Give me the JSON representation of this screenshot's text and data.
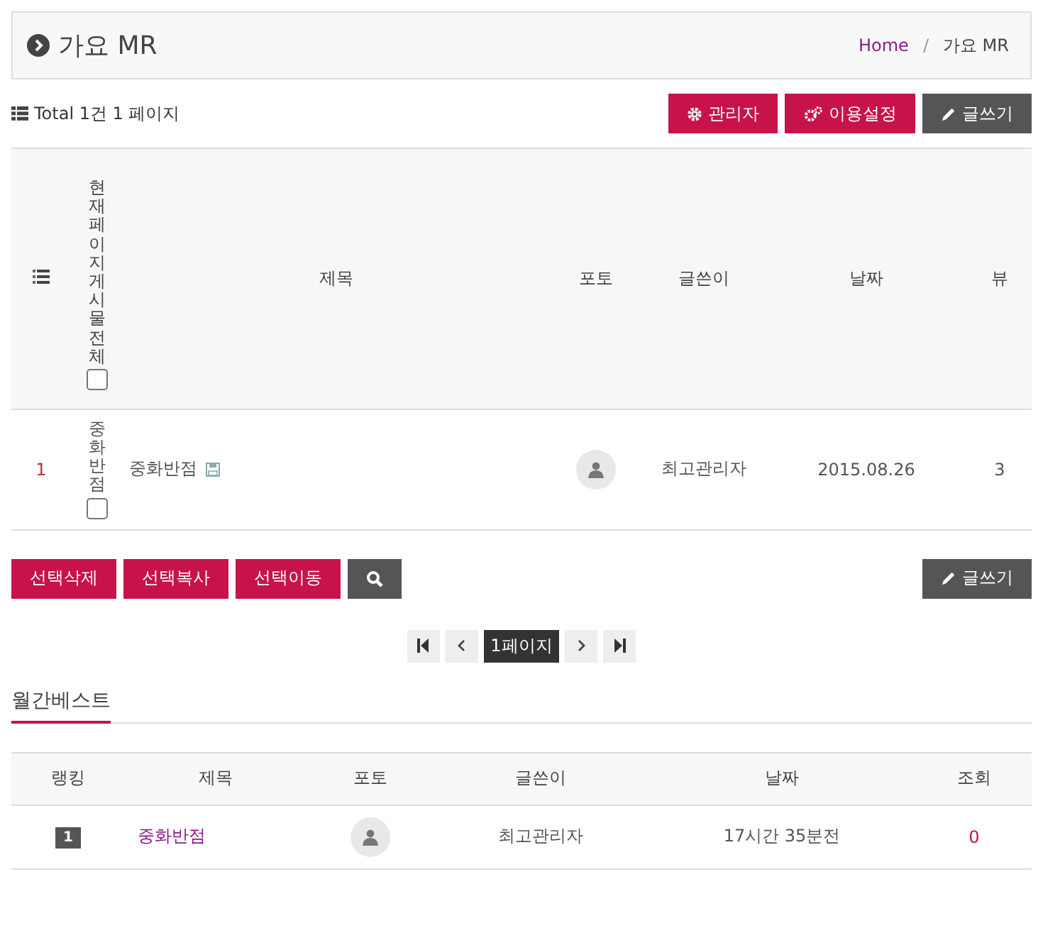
{
  "header": {
    "title": "가요 MR",
    "breadcrumb": [
      {
        "label": "Home",
        "kind": "link"
      },
      {
        "label": "/",
        "kind": "separator"
      },
      {
        "label": "가요 MR",
        "kind": "current"
      }
    ]
  },
  "toolbar": {
    "summary": "Total 1건 1 페이지",
    "buttons": [
      {
        "label": "관리자",
        "kind": "admin"
      },
      {
        "label": "이용설정",
        "kind": "settings"
      },
      {
        "label": "글쓰기",
        "kind": "write"
      }
    ]
  },
  "table": {
    "select_all": {
      "label": "현재페이지게시물전체",
      "checked": false
    },
    "columns": [
      "제목",
      "포토",
      "글쓴이",
      "날짜",
      "뷰"
    ],
    "rows": [
      {
        "number": "1",
        "select_label": "중화반점",
        "checked": false,
        "title": "중화반점",
        "author": "최고관리자",
        "date": "2015.08.26",
        "views": "3"
      }
    ]
  },
  "actions": [
    {
      "label": "선택삭제",
      "kind": "primary"
    },
    {
      "label": "선택복사",
      "kind": "primary"
    },
    {
      "label": "선택이동",
      "kind": "primary"
    },
    {
      "kind": "search"
    }
  ],
  "write_button": {
    "label": "글쓰기"
  },
  "pagination": {
    "pages": [
      {
        "label": "1페이지",
        "selected": true
      }
    ]
  },
  "best": {
    "title": "월간베스트",
    "columns": [
      "랭킹",
      "제목",
      "포토",
      "글쓴이",
      "날짜",
      "조회"
    ],
    "rows": [
      {
        "rank": "1",
        "title": "중화반점",
        "author": "최고관리자",
        "time": "17시간 35분전",
        "views": "0"
      }
    ]
  }
}
